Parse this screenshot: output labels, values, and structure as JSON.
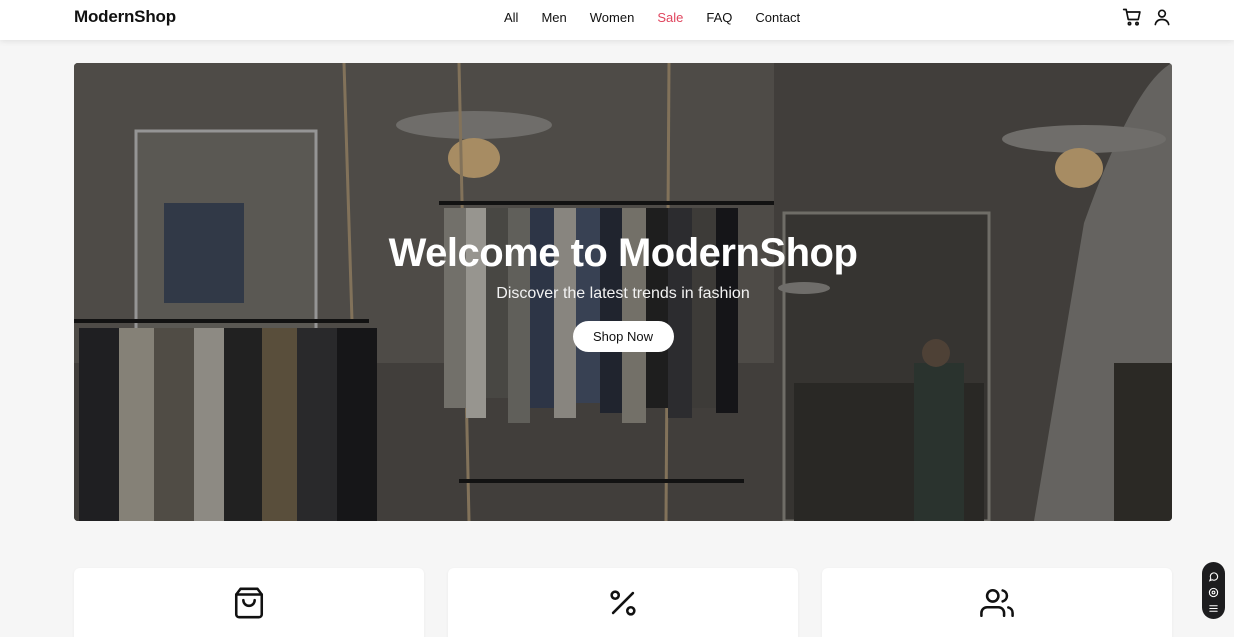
{
  "header": {
    "logo": "ModernShop",
    "nav": [
      "All",
      "Men",
      "Women",
      "Sale",
      "FAQ",
      "Contact"
    ],
    "icons": [
      "cart-icon",
      "user-icon"
    ]
  },
  "hero": {
    "title": "Welcome to ModernShop",
    "subtitle": "Discover the latest trends in fashion",
    "button_label": "Shop Now"
  },
  "features": [
    {
      "icon": "shopping-bag-icon",
      "label": ""
    },
    {
      "icon": "percent-icon",
      "label": ""
    },
    {
      "icon": "users-icon",
      "label": ""
    }
  ],
  "colors": {
    "sale": "#e0455e",
    "widget": "#1d1d1f"
  },
  "widget": {
    "icons": [
      "chat-icon",
      "eye-icon",
      "settings-icon"
    ]
  }
}
